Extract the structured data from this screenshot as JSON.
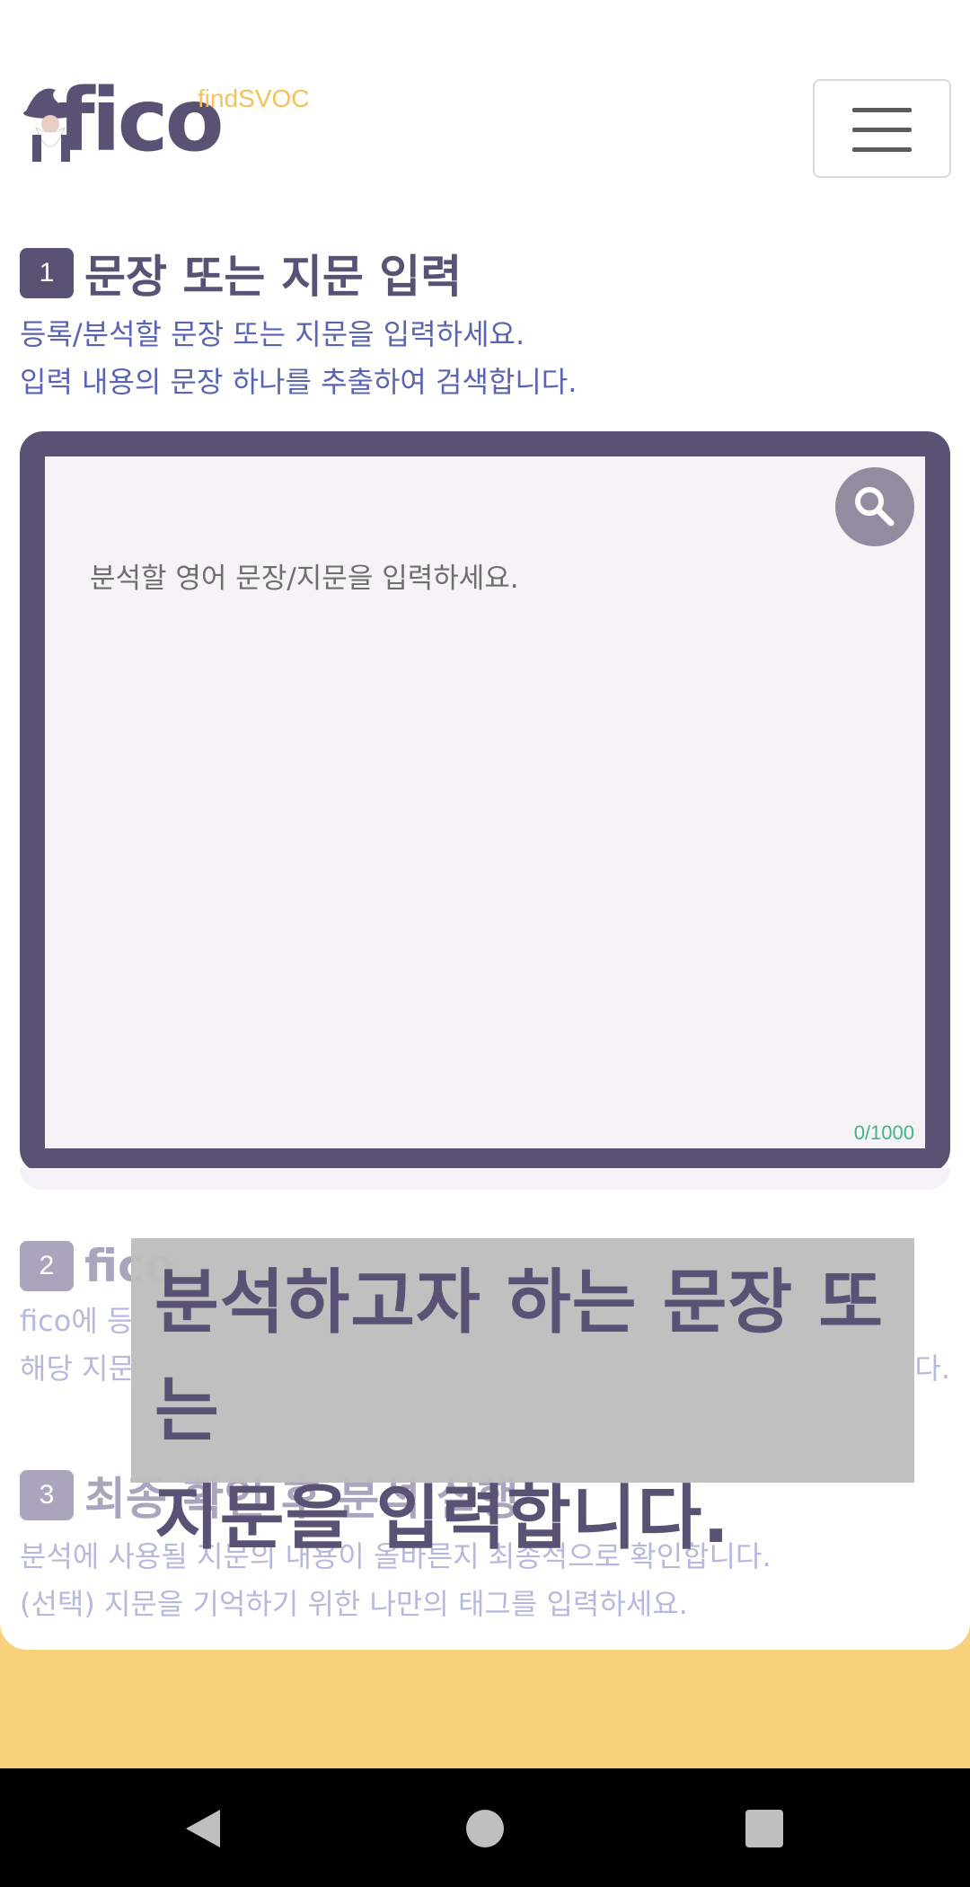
{
  "header": {
    "logo_text": "fico",
    "logo_sub": "findSVOC",
    "menu_icon": "hamburger-menu-icon"
  },
  "steps": [
    {
      "number": "1",
      "title": "문장 또는 지문 입력",
      "desc_lines": [
        "등록/분석할 문장 또는 지문을 입력하세요.",
        "입력 내용의 문장 하나를 추출하여 검색합니다."
      ]
    },
    {
      "number": "2",
      "title": "fico",
      "desc_lines": [
        "fico에 등",
        "해당 지문",
        "다."
      ]
    },
    {
      "number": "3",
      "title": "최종 확인 후 분석 실행",
      "desc_lines": [
        "분석에 사용될 지문의 내용이 올바른지 최종적으로 확인합니다.",
        "(선택) 지문을 기억하기 위한 나만의 태그를 입력하세요."
      ]
    }
  ],
  "input": {
    "placeholder": "분석할 영어 문장/지문을 입력하세요.",
    "value": "",
    "counter": "0/1000",
    "search_icon": "search-icon"
  },
  "overlay": {
    "lines": [
      "분석하고자 하는 문장 또는",
      "지문을 입력합니다."
    ]
  },
  "colors": {
    "primary": "#5a5275",
    "link_text": "#5a64b4",
    "accent_yellow": "#f7d27b",
    "counter_green": "#3fb58a"
  },
  "navbar": {
    "back_icon": "back-triangle-icon",
    "home_icon": "home-circle-icon",
    "recents_icon": "recents-square-icon"
  }
}
